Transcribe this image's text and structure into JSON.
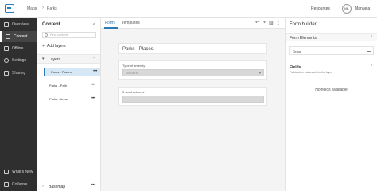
{
  "topbar": {
    "breadcrumb": [
      "Maps",
      "Parks"
    ],
    "breadcrumb_sep": "›",
    "resources_label": "Resources",
    "avatar_initials": "ML",
    "user_name": "Manuela"
  },
  "leftnav": {
    "items": [
      {
        "label": "Overview",
        "icon": "grid-icon"
      },
      {
        "label": "Content",
        "icon": "layers-icon"
      },
      {
        "label": "Offline",
        "icon": "device-icon"
      },
      {
        "label": "Settings",
        "icon": "gear-icon"
      },
      {
        "label": "Sharing",
        "icon": "share-icon"
      }
    ],
    "active": "Content",
    "whats_new": "What's New",
    "collapse": "Collapse"
  },
  "content": {
    "title": "Content",
    "close": "«",
    "search_placeholder": "Find content",
    "add_layers": "Add layers",
    "layers_label": "Layers",
    "layers": [
      {
        "name": "Parks - Places",
        "selected": true
      },
      {
        "name": "Parks - Path",
        "selected": false
      },
      {
        "name": "Parks - Areas",
        "selected": false
      }
    ],
    "basemap_label": "Basemap"
  },
  "main": {
    "tabs": [
      "Form",
      "Templates"
    ],
    "active_tab": "Form",
    "form_title": "Parks - Places",
    "fields": [
      {
        "label": "Type of amenity",
        "placeholder": "No value",
        "kind": "select"
      },
      {
        "label": "3 word address",
        "placeholder": "",
        "kind": "text"
      }
    ]
  },
  "formbuilder": {
    "title": "Form builder",
    "elements_label": "Form Elements",
    "group_label": "Group",
    "fields_label": "Fields",
    "fields_sub": "Fields store values within the layer",
    "no_fields": "No fields available"
  },
  "colors": {
    "accent": "#2b7ab3",
    "nav_bg": "#2f2f2f",
    "selected_row": "#d6e8f6"
  }
}
